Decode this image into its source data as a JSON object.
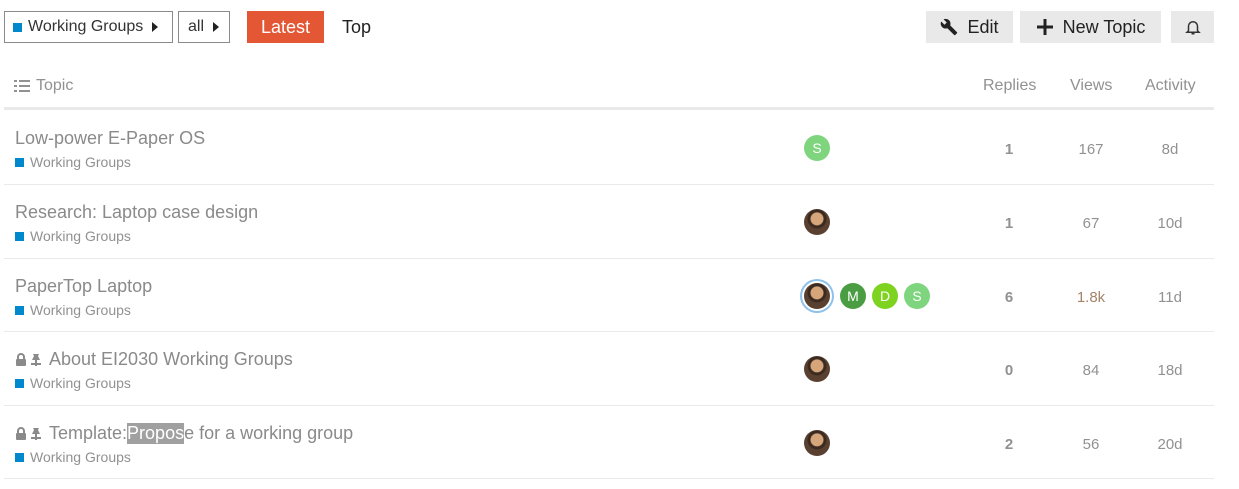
{
  "nav": {
    "category_drop": {
      "label": "Working Groups",
      "color": "#0088cc"
    },
    "sub_drop": {
      "label": "all"
    },
    "tabs": [
      {
        "label": "Latest",
        "active": true,
        "color": "#e45735"
      },
      {
        "label": "Top",
        "active": false
      }
    ],
    "edit_label": "Edit",
    "new_topic_label": "New Topic",
    "bell_icon": "bell-icon"
  },
  "table": {
    "headers": {
      "topic": "Topic",
      "replies": "Replies",
      "views": "Views",
      "activity": "Activity"
    },
    "rows": [
      {
        "title": "Low-power E-Paper OS",
        "category": "Working Groups",
        "posters": [
          {
            "letter": "S",
            "color": "#7ed57e"
          }
        ],
        "replies": "1",
        "views": "167",
        "activity": "8d"
      },
      {
        "title": "Research: Laptop case design",
        "category": "Working Groups",
        "posters": [
          {
            "type": "photo"
          }
        ],
        "replies": "1",
        "views": "67",
        "activity": "10d"
      },
      {
        "title": "PaperTop Laptop",
        "category": "Working Groups",
        "posters": [
          {
            "type": "photo",
            "ring": true
          },
          {
            "letter": "M",
            "color": "#4a9d42"
          },
          {
            "letter": "D",
            "color": "#7ed321"
          },
          {
            "letter": "S",
            "color": "#7ed57e"
          }
        ],
        "replies": "6",
        "views": "1.8k",
        "views_hot": true,
        "activity": "11d"
      },
      {
        "title": "About EI2030 Working Groups",
        "locked": true,
        "pinned": true,
        "category": "Working Groups",
        "posters": [
          {
            "type": "photo"
          }
        ],
        "replies": "0",
        "views": "84",
        "activity": "18d"
      },
      {
        "title_before": "Template: ",
        "title_highlight": "Propos",
        "title_after": "e for a working group",
        "locked": true,
        "pinned": true,
        "category": "Working Groups",
        "posters": [
          {
            "type": "photo"
          }
        ],
        "replies": "2",
        "views": "56",
        "activity": "20d"
      }
    ]
  }
}
